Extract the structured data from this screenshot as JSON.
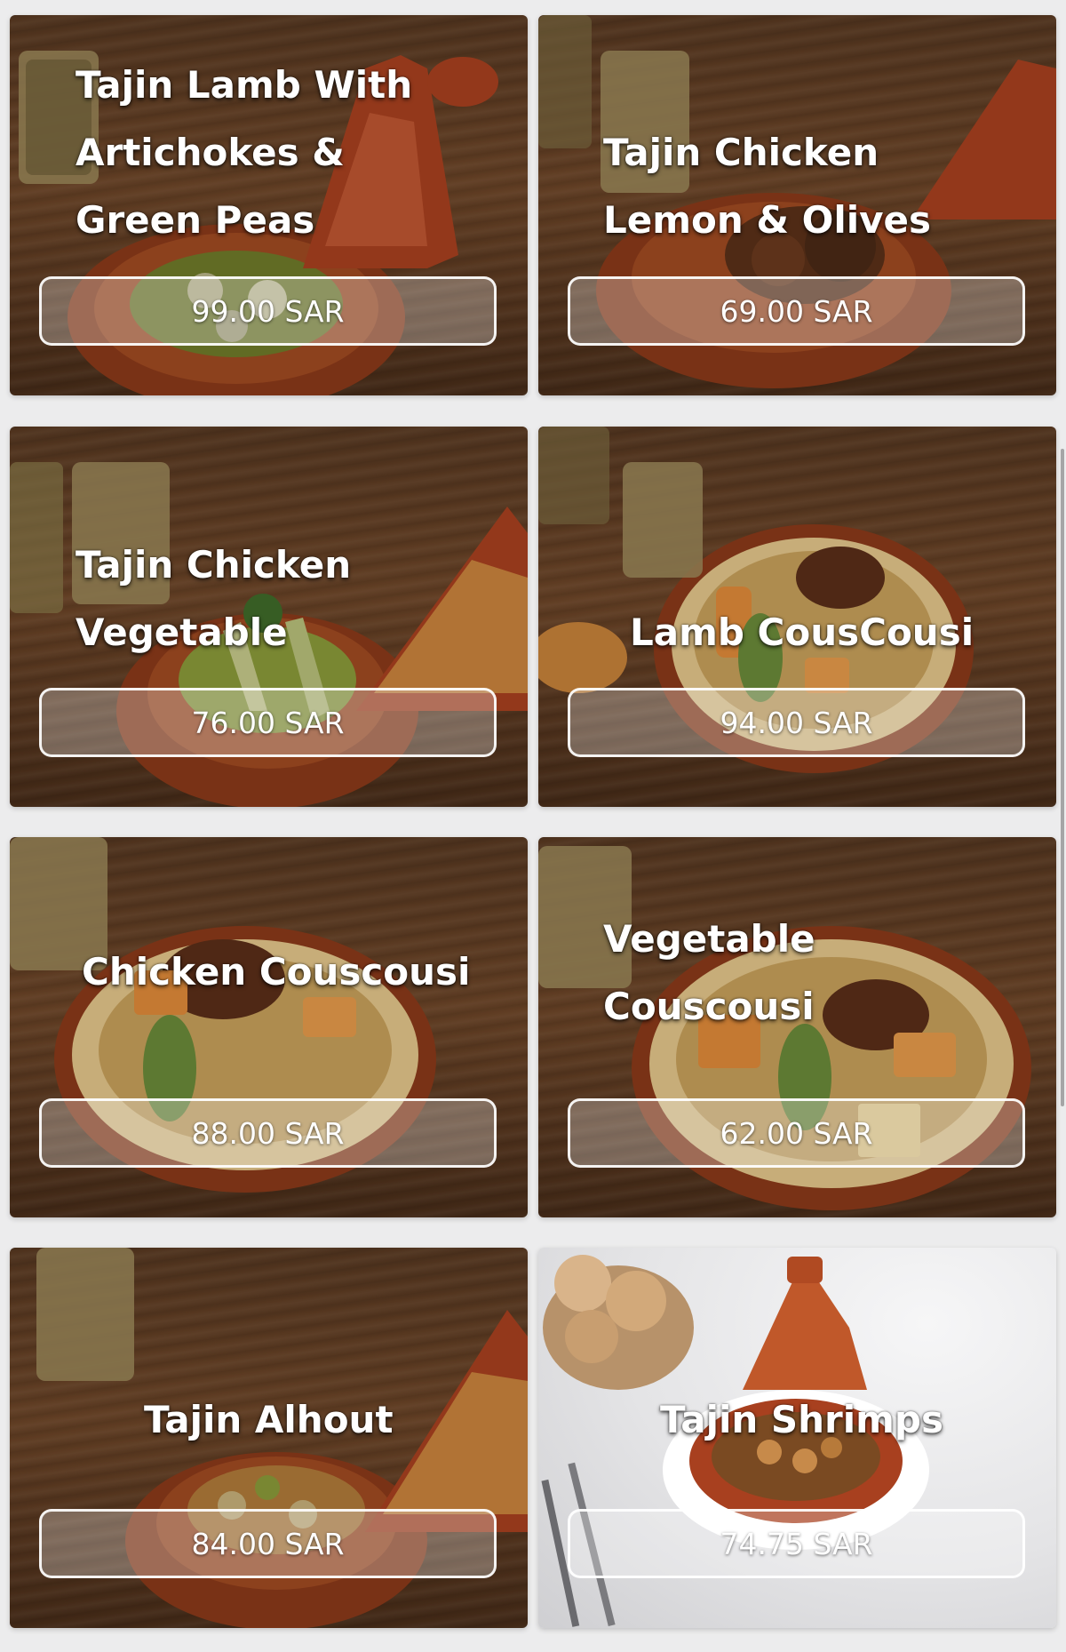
{
  "currency_color": "#ffffff",
  "items": [
    {
      "name": "Tajin Lamb With\nArtichokes &\nGreen Peas",
      "price": "99.00 SAR",
      "image_icon": "tajine-lamb-artichoke-icon"
    },
    {
      "name": "Tajin Chicken\nLemon & Olives",
      "price": "69.00 SAR",
      "image_icon": "tajine-chicken-lemon-icon"
    },
    {
      "name": "Tajin Chicken\nVegetable",
      "price": "76.00 SAR",
      "image_icon": "tajine-chicken-vegetable-icon"
    },
    {
      "name": "Lamb CousCousi",
      "price": "94.00 SAR",
      "image_icon": "couscous-lamb-icon"
    },
    {
      "name": "Chicken Couscousi",
      "price": "88.00 SAR",
      "image_icon": "couscous-chicken-icon"
    },
    {
      "name": "Vegetable\nCouscousi",
      "price": "62.00 SAR",
      "image_icon": "couscous-vegetable-icon"
    },
    {
      "name": "Tajin Alhout",
      "price": "84.00 SAR",
      "image_icon": "tajine-fish-icon"
    },
    {
      "name": "Tajin Shrimps",
      "price": "74.75 SAR",
      "image_icon": "tajine-shrimp-icon"
    }
  ]
}
